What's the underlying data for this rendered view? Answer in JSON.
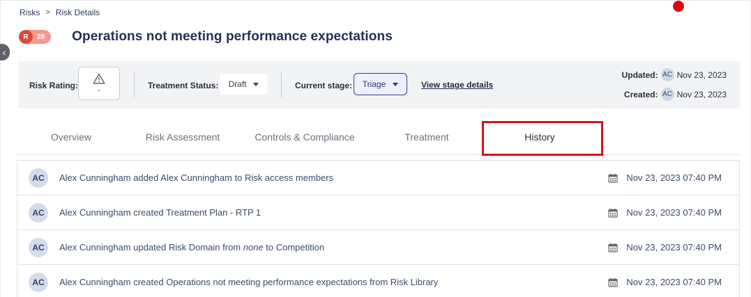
{
  "breadcrumb": {
    "items": [
      "Risks",
      "Risk Details"
    ],
    "separator": ">"
  },
  "risk": {
    "badge_letter": "R",
    "badge_number": "28",
    "title": "Operations not meeting performance expectations"
  },
  "info": {
    "rating_label": "Risk Rating:",
    "rating_value": "-",
    "treatment_label": "Treatment Status:",
    "treatment_value": "Draft",
    "stage_label": "Current stage:",
    "stage_value": "Triage",
    "stage_link": "View stage details",
    "updated_label": "Updated:",
    "updated_avatar": "AC",
    "updated_date": "Nov 23, 2023",
    "created_label": "Created:",
    "created_avatar": "AC",
    "created_date": "Nov 23, 2023"
  },
  "tabs": [
    {
      "label": "Overview"
    },
    {
      "label": "Risk Assessment"
    },
    {
      "label": "Controls & Compliance"
    },
    {
      "label": "Treatment"
    },
    {
      "label": "History",
      "active": true
    }
  ],
  "history": [
    {
      "avatar": "AC",
      "text": "Alex Cunningham added Alex Cunningham to Risk access members",
      "date": "Nov 23, 2023 07:40 PM"
    },
    {
      "avatar": "AC",
      "text": "Alex Cunningham created Treatment Plan - RTP 1",
      "date": "Nov 23, 2023 07:40 PM"
    },
    {
      "avatar": "AC",
      "text_before": "Alex Cunningham updated Risk Domain from ",
      "text_italic": "none",
      "text_after": " to Competition",
      "date": "Nov 23, 2023 07:40 PM"
    },
    {
      "avatar": "AC",
      "text": "Alex Cunningham created Operations not meeting performance expectations from Risk Library",
      "date": "Nov 23, 2023 07:40 PM"
    }
  ],
  "colors": {
    "highlight": "#d8101e",
    "notification_dot": "#e3000f",
    "stage_accent": "#3d3d8f",
    "risk_badge": "#e0463a"
  },
  "icons": [
    "chevron-left-icon",
    "warning-triangle-icon",
    "caret-down-icon",
    "calendar-icon"
  ]
}
